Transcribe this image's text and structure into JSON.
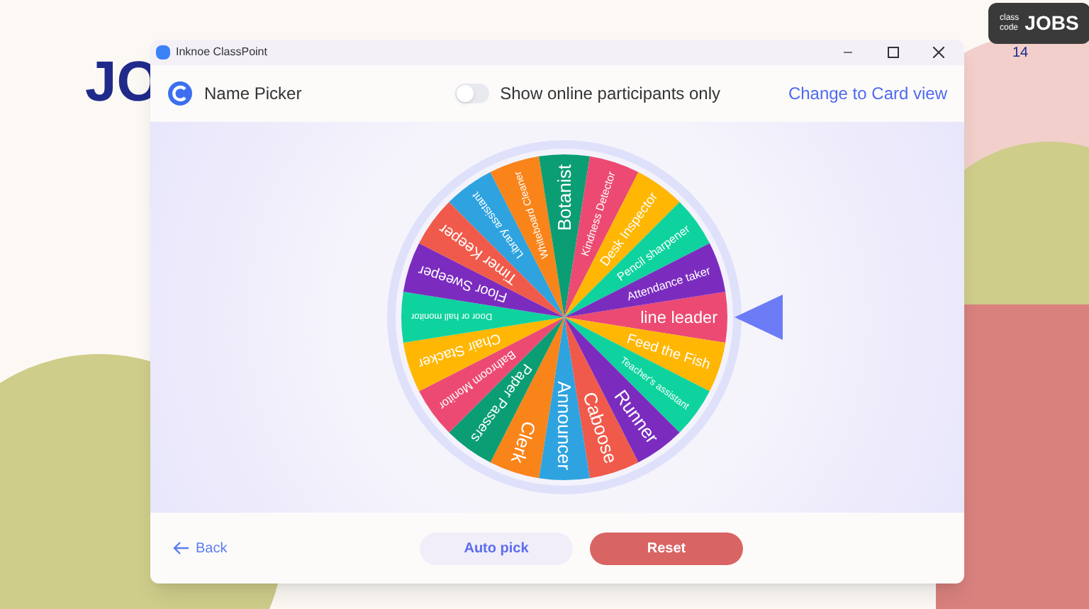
{
  "slide": {
    "title_fragment": "JO",
    "class_code_label": [
      "class",
      "code"
    ],
    "class_code": "JOBS",
    "page_number": "14"
  },
  "window": {
    "title": "Inknoe ClassPoint"
  },
  "header": {
    "title": "Name Picker",
    "toggle": {
      "label": "Show online participants only",
      "on": false
    },
    "link": "Change to Card view"
  },
  "wheel": {
    "segments": [
      {
        "label": "line leader",
        "color": "#ec4a72"
      },
      {
        "label": "Feed the Fish",
        "color": "#ffb703"
      },
      {
        "label": "Teacher's assistant",
        "color": "#0fd39e"
      },
      {
        "label": "Runner",
        "color": "#7b2cbf"
      },
      {
        "label": "Caboose",
        "color": "#f05a4a"
      },
      {
        "label": "Announcer",
        "color": "#2ea3e0"
      },
      {
        "label": "Clerk",
        "color": "#f9841a"
      },
      {
        "label": "Paper Passers",
        "color": "#0b9e74"
      },
      {
        "label": "Bathroom Monitor",
        "color": "#ec4a72"
      },
      {
        "label": "Chair Stacker",
        "color": "#ffb703"
      },
      {
        "label": "Door or hall monitor",
        "color": "#0fd39e"
      },
      {
        "label": "Floor Sweeper",
        "color": "#7b2cbf"
      },
      {
        "label": "Timer Keeper",
        "color": "#f05a4a"
      },
      {
        "label": "Library assistant",
        "color": "#2ea3e0"
      },
      {
        "label": "Whiteboard Cleaner",
        "color": "#f9841a"
      },
      {
        "label": "Botanist",
        "color": "#0b9e74"
      },
      {
        "label": "Kindness Detector",
        "color": "#ec4a72"
      },
      {
        "label": "Desk Inspector",
        "color": "#ffb703"
      },
      {
        "label": "Pencil sharpener",
        "color": "#0fd39e"
      },
      {
        "label": "Attendance taker",
        "color": "#7b2cbf"
      }
    ]
  },
  "footer": {
    "back": "Back",
    "buttons": [
      {
        "label": "Auto pick",
        "kind": "secondary"
      },
      {
        "label": "Reset",
        "kind": "danger"
      }
    ]
  }
}
